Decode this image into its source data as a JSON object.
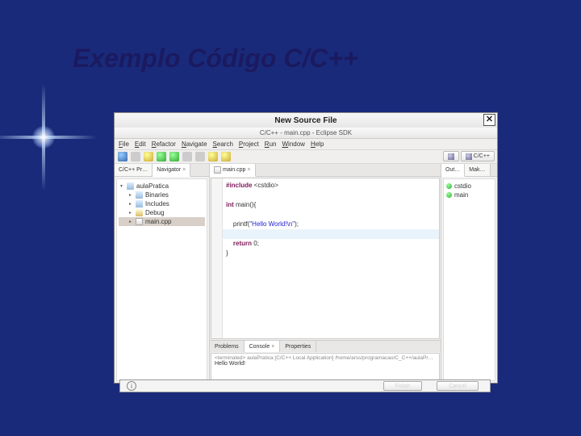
{
  "slide": {
    "title": "Exemplo Código C/C++"
  },
  "modal": {
    "title": "New Source File",
    "close": "✕"
  },
  "ide": {
    "window_title": "C/C++ - main.cpp - Eclipse SDK",
    "menus": [
      "File",
      "Edit",
      "Refactor",
      "Navigate",
      "Search",
      "Project",
      "Run",
      "Window",
      "Help"
    ],
    "perspective": {
      "label": "C/C++"
    }
  },
  "left_tabs": [
    {
      "label": "C/C++ Pr…",
      "active": false
    },
    {
      "label": "Navigator",
      "active": true
    }
  ],
  "tree": {
    "root": "aulaPratica",
    "children": [
      {
        "label": "Binaries",
        "icon": "fold-blue"
      },
      {
        "label": "Includes",
        "icon": "fold-blue"
      },
      {
        "label": "Debug",
        "icon": "fold-yel"
      },
      {
        "label": "main.cpp",
        "icon": "file-c",
        "selected": true
      }
    ]
  },
  "editor": {
    "tab": "main.cpp",
    "lines": [
      {
        "t": "#include <cstdio>",
        "cls": "kw"
      },
      {
        "t": ""
      },
      {
        "t": "int main(){",
        "k1": "int"
      },
      {
        "t": ""
      },
      {
        "t": "    printf(\"Hello World!\\n\");",
        "str": "\"Hello World!\\n\""
      },
      {
        "t": ""
      },
      {
        "t": "    return 0;",
        "k1": "return"
      },
      {
        "t": "}"
      }
    ]
  },
  "right_tabs": [
    {
      "label": "Out…",
      "active": true
    },
    {
      "label": "Mak…",
      "active": false
    }
  ],
  "outline": [
    {
      "label": "cstdio"
    },
    {
      "label": "main"
    }
  ],
  "bottom": {
    "tabs": [
      {
        "label": "Problems",
        "active": false
      },
      {
        "label": "Console",
        "active": true
      },
      {
        "label": "Properties",
        "active": false
      }
    ],
    "console_header": "<terminated> aulaPratica [C/C++ Local Application] /home/arss/programacao/C_C++/aulaPratica/Debug/au",
    "console_output": "Hello World!"
  },
  "dialog_cut": {
    "info_icon": "i",
    "btn1": "Finish",
    "btn2": "Cancel"
  }
}
